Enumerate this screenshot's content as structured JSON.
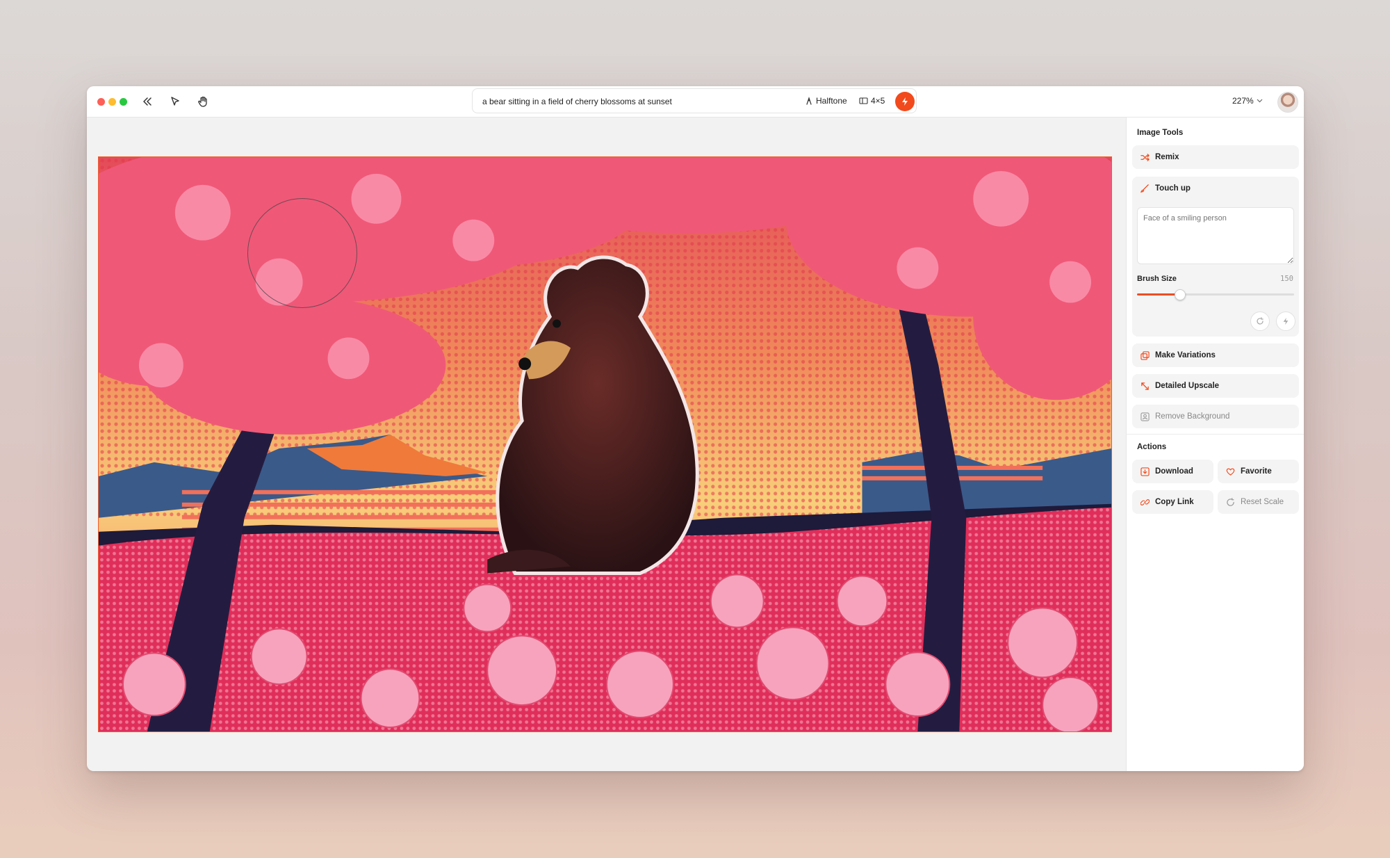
{
  "toolbar": {
    "prompt": "a bear sitting in a field of cherry blossoms at sunset",
    "style_label": "Halftone",
    "ratio_label": "4×5",
    "zoom_label": "227%",
    "icons": [
      "collapse-icon",
      "pointer-icon",
      "hand-icon",
      "style-icon",
      "ratio-icon",
      "lightning-icon",
      "chevron-down-icon"
    ]
  },
  "panel": {
    "image_tools_title": "Image Tools",
    "remix_label": "Remix",
    "touch_up_label": "Touch up",
    "touch_up_placeholder": "Face of a smiling person",
    "brush_size_label": "Brush Size",
    "brush_size_value": "150",
    "brush_size_fraction": 0.27,
    "make_variations_label": "Make Variations",
    "detailed_upscale_label": "Detailed Upscale",
    "remove_background_label": "Remove Background",
    "actions_title": "Actions",
    "download_label": "Download",
    "favorite_label": "Favorite",
    "copy_link_label": "Copy Link",
    "reset_scale_label": "Reset Scale"
  },
  "colors": {
    "accent": "#f24a1c",
    "selection_border": "#f05a2a"
  }
}
